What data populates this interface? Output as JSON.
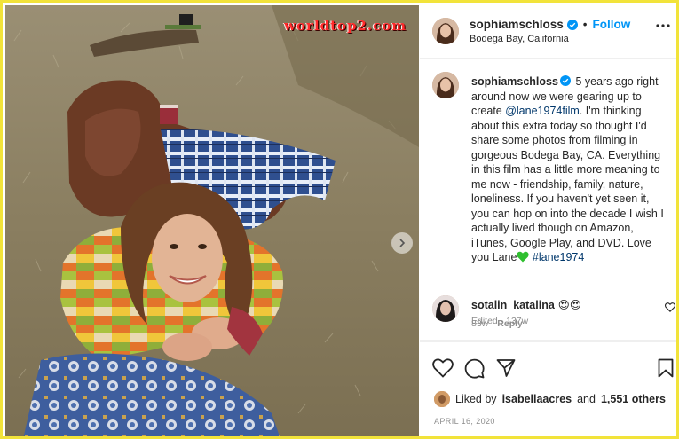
{
  "watermark": "worldtop2.com",
  "header": {
    "username": "sophiamschloss",
    "separator": "•",
    "follow_label": "Follow",
    "location": "Bodega Bay, California"
  },
  "caption": {
    "username": "sophiamschloss",
    "text_before_mention": "5 years ago right around now we were gearing up to create ",
    "mention": "@lane1974film",
    "text_after_mention": ". I'm thinking about this extra today so thought I'd share some photos from filming in gorgeous Bodega Bay, CA. Everything in this film has a little more meaning to me now - friendship, family, nature, loneliness. If you haven't yet seen it, you can hop on into the decade I wish I actually lived though on Amazon, iTunes, Google Play, and DVD. Love you Lane",
    "hashtag": "#lane1974",
    "edited": "Edited · 137w"
  },
  "comment": {
    "username": "sotalin_katalina",
    "emoji": "😍😍",
    "age": "83w",
    "reply_label": "Reply"
  },
  "likes": {
    "prefix": "Liked by",
    "liker": "isabellaacres",
    "middle": "and",
    "count": "1,551 others"
  },
  "date": "APRIL 16, 2020",
  "icons": {
    "verified": "verified-badge-icon",
    "more": "more-options-icon",
    "next": "chevron-right-icon",
    "like": "heart-icon",
    "comment": "comment-icon",
    "share": "share-icon",
    "save": "bookmark-icon",
    "green_heart": "green-heart-icon"
  },
  "colors": {
    "link": "#0095f6",
    "mention": "#00376b",
    "muted": "#8e8e8e",
    "frame_border": "#f2e33a",
    "watermark": "#ff2b2b"
  }
}
